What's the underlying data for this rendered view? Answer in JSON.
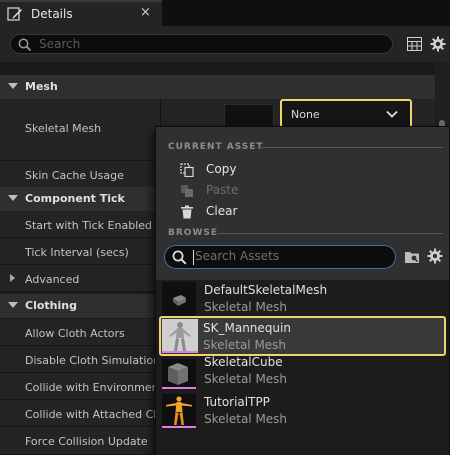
{
  "tab": {
    "title": "Details",
    "close_glyph": "×",
    "icon": "pencil-icon"
  },
  "toolbar": {
    "search_placeholder": "Search",
    "grid_icon": "table-grid-icon",
    "settings_icon": "gear-icon"
  },
  "categories": {
    "mesh": "Mesh",
    "component_tick": "Component Tick",
    "advanced": "Advanced",
    "clothing": "Clothing"
  },
  "properties": {
    "skeletal_mesh": "Skeletal Mesh",
    "skin_cache_usage": "Skin Cache Usage",
    "start_with_tick": "Start with Tick Enabled",
    "tick_interval": "Tick Interval (secs)",
    "allow_cloth_actors": "Allow Cloth Actors",
    "disable_cloth_simulation": "Disable Cloth Simulation",
    "collide_with_environment": "Collide with Environment",
    "collide_with_attached_children": "Collide with Attached Childr",
    "force_collision_update": "Force Collision Update"
  },
  "combo": {
    "value": "None"
  },
  "popup": {
    "current_asset_header": "CURRENT ASSET",
    "browse_header": "BROWSE",
    "copy": "Copy",
    "paste": "Paste",
    "clear": "Clear",
    "search_placeholder": "Search Assets"
  },
  "assets": [
    {
      "name": "DefaultSkeletalMesh",
      "type": "Skeletal Mesh",
      "selected": false,
      "icon": "default-mesh-thumbnail"
    },
    {
      "name": "SK_Mannequin",
      "type": "Skeletal Mesh",
      "selected": true,
      "icon": "mannequin-thumbnail"
    },
    {
      "name": "SkeletalCube",
      "type": "Skeletal Mesh",
      "selected": false,
      "icon": "cube-thumbnail"
    },
    {
      "name": "TutorialTPP",
      "type": "Skeletal Mesh",
      "selected": false,
      "icon": "tutorial-character-thumbnail"
    }
  ],
  "colors": {
    "highlight": "#f1d56b",
    "skeletal_mesh_type": "#e07ee6",
    "search_focus": "#3d6fae"
  }
}
